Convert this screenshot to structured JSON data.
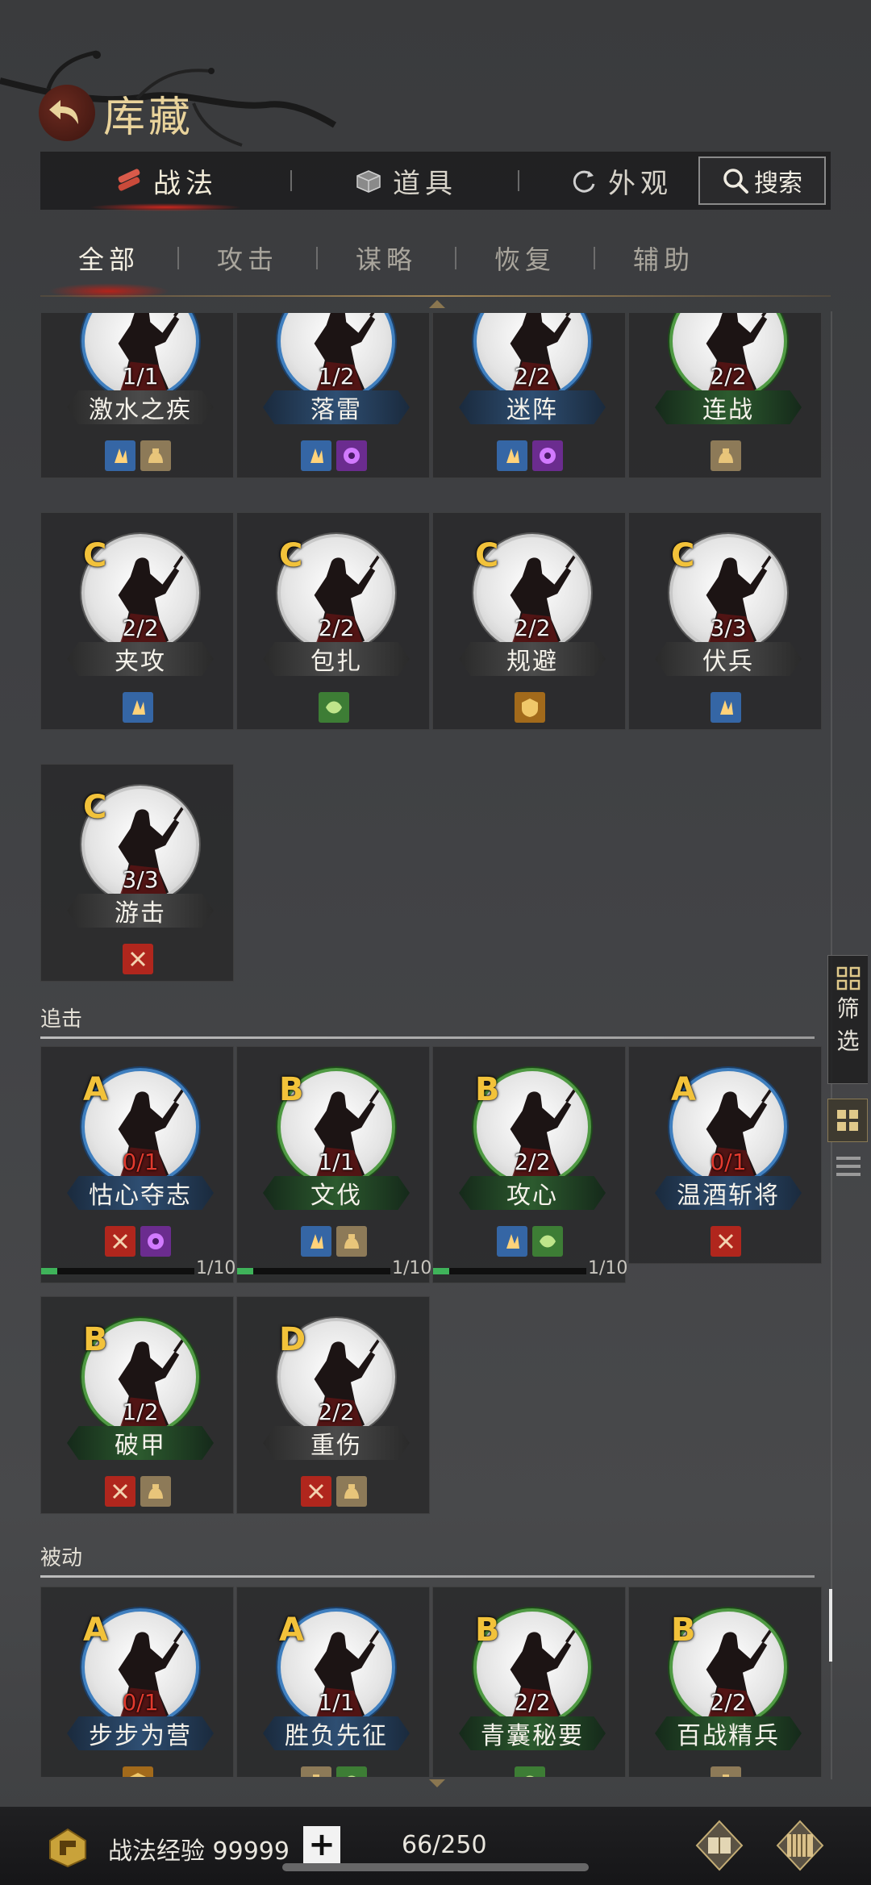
{
  "header": {
    "title": "库藏",
    "back_icon": "back-arrow-icon"
  },
  "top_tabs": [
    {
      "label": "战法",
      "icon": "scroll-bundle-icon",
      "active": true
    },
    {
      "label": "道具",
      "icon": "chest-icon",
      "active": false
    },
    {
      "label": "外观",
      "icon": "refresh-icon",
      "active": false
    }
  ],
  "search": {
    "label": "搜索"
  },
  "category_tabs": [
    "全部",
    "攻击",
    "谋略",
    "恢复",
    "辅助"
  ],
  "sections": {
    "pursuit": "追击",
    "passive": "被动"
  },
  "cards_active": [
    {
      "name": "激水之疾",
      "count": "1/1",
      "band": "grey",
      "ring": "blue",
      "tags": [
        "blue",
        "gold"
      ]
    },
    {
      "name": "落雷",
      "count": "1/2",
      "band": "blue",
      "ring": "blue",
      "tags": [
        "blue",
        "purple"
      ]
    },
    {
      "name": "迷阵",
      "count": "2/2",
      "band": "blue",
      "ring": "blue",
      "tags": [
        "blue",
        "purple"
      ]
    },
    {
      "name": "连战",
      "count": "2/2",
      "band": "green",
      "ring": "green",
      "tags": [
        "gold"
      ]
    },
    {
      "grade": "C",
      "name": "夹攻",
      "count": "2/2",
      "band": "grey",
      "ring": "grey",
      "tags": [
        "blue"
      ]
    },
    {
      "grade": "C",
      "name": "包扎",
      "count": "2/2",
      "band": "grey",
      "ring": "grey",
      "tags": [
        "green"
      ]
    },
    {
      "grade": "C",
      "name": "规避",
      "count": "2/2",
      "band": "grey",
      "ring": "grey",
      "tags": [
        "orange"
      ]
    },
    {
      "grade": "C",
      "name": "伏兵",
      "count": "3/3",
      "band": "grey",
      "ring": "grey",
      "tags": [
        "blue"
      ]
    },
    {
      "grade": "C",
      "name": "游击",
      "count": "3/3",
      "band": "grey",
      "ring": "grey",
      "tags": [
        "red"
      ]
    }
  ],
  "cards_pursuit": [
    {
      "grade": "A",
      "name": "怙心夺志",
      "count": "0/1",
      "count_red": true,
      "band": "blue",
      "ring": "blue",
      "tags": [
        "red",
        "purple"
      ],
      "progress": "1/10"
    },
    {
      "grade": "B",
      "name": "文伐",
      "count": "1/1",
      "band": "green",
      "ring": "green",
      "tags": [
        "blue",
        "gold"
      ],
      "progress": "1/10"
    },
    {
      "grade": "B",
      "name": "攻心",
      "count": "2/2",
      "band": "green",
      "ring": "green",
      "tags": [
        "blue",
        "green"
      ],
      "progress": "1/10"
    },
    {
      "grade": "A",
      "name": "温酒斩将",
      "count": "0/1",
      "count_red": true,
      "band": "blue",
      "ring": "blue",
      "tags": [
        "red"
      ]
    },
    {
      "grade": "B",
      "name": "破甲",
      "count": "1/2",
      "band": "green",
      "ring": "green",
      "tags": [
        "red",
        "gold"
      ]
    },
    {
      "grade": "D",
      "name": "重伤",
      "count": "2/2",
      "band": "grey",
      "ring": "grey",
      "tags": [
        "red",
        "gold"
      ]
    }
  ],
  "cards_passive": [
    {
      "grade": "A",
      "name": "步步为营",
      "count": "0/1",
      "count_red": true,
      "band": "blue",
      "ring": "blue",
      "tags": [
        "orange"
      ]
    },
    {
      "grade": "A",
      "name": "胜负先征",
      "count": "1/1",
      "band": "blue",
      "ring": "blue",
      "tags": [
        "gold",
        "green"
      ]
    },
    {
      "grade": "B",
      "name": "青囊秘要",
      "count": "2/2",
      "band": "green",
      "ring": "green",
      "tags": [
        "green"
      ]
    },
    {
      "grade": "B",
      "name": "百战精兵",
      "count": "2/2",
      "band": "green",
      "ring": "green",
      "tags": [
        "gold"
      ]
    }
  ],
  "side": {
    "filter_label_1": "筛",
    "filter_label_2": "选"
  },
  "bottom": {
    "exp_label": "战法经验 99999",
    "plus": "+",
    "capacity": "66/250"
  }
}
